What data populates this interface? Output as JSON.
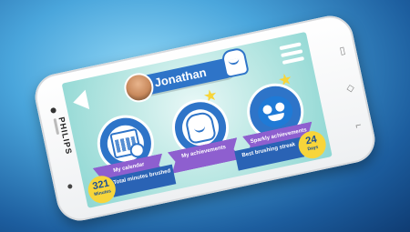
{
  "device": {
    "brand": "PHILIPS"
  },
  "header": {
    "username": "Jonathan"
  },
  "tiles": [
    {
      "label": "My calendar"
    },
    {
      "label": "My achievements"
    },
    {
      "label": "Sparkly achievements"
    }
  ],
  "stats": {
    "minutes": {
      "value": "321",
      "unit": "Minutes",
      "label": "Total minutes brushed"
    },
    "streak": {
      "value": "24",
      "unit": "Days",
      "label": "Best brushing streak"
    }
  },
  "colors": {
    "accent": "#2e74c8",
    "ribbon": "#8e5fcf",
    "highlight": "#f7d53a",
    "screen_bg": "#bfe9e5"
  }
}
